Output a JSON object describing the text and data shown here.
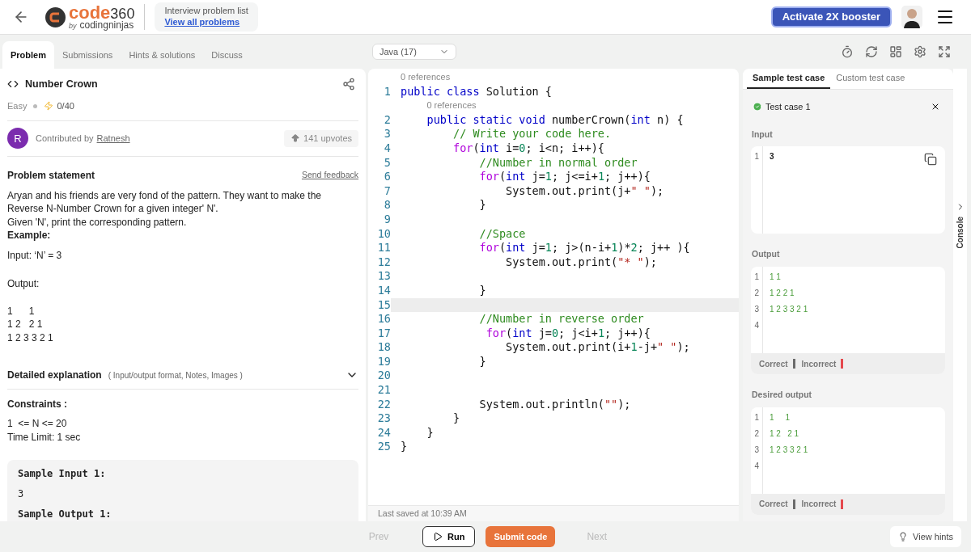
{
  "header": {
    "logo": {
      "word": "code",
      "number": "360",
      "by": "by",
      "brand": "codingninjas"
    },
    "list_box": {
      "title": "Interview problem list",
      "link": "View all problems"
    },
    "booster_button": "Activate 2X booster"
  },
  "problem_tabs": [
    {
      "label": "Problem",
      "selected": true
    },
    {
      "label": "Submissions",
      "selected": false
    },
    {
      "label": "Hints & solutions",
      "selected": false
    },
    {
      "label": "Discuss",
      "selected": false
    }
  ],
  "problem": {
    "title": "Number Crown",
    "difficulty": "Easy",
    "score": "0/40",
    "avatar_letter": "R",
    "contributed_by": "Contributed by",
    "author": "Ratnesh",
    "upvotes": "141 upvotes",
    "statement_heading": "Problem statement",
    "feedback_link": "Send feedback",
    "paragraphs": [
      "Aryan and his friends are very fond of the pattern. They want to make the Reverse N-Number Crown for a given integer' N'.",
      "Given 'N', print the corresponding pattern."
    ],
    "example_heading": "Example:",
    "example_input": "Input: ‘N’ = 3",
    "output_label": "Output:",
    "pattern": [
      "1      1",
      "1 2   2 1",
      "1 2 3 3 2 1"
    ],
    "explanation": {
      "heading": "Detailed explanation",
      "hint": "( Input/output format, Notes, Images )",
      "expanded": false
    },
    "constraints_heading": "Constraints :",
    "constraints": [
      "1  <= N <= 20",
      "Time Limit: 1 sec"
    ],
    "sample": [
      {
        "kind": "heading",
        "text": "Sample Input 1:"
      },
      {
        "kind": "value",
        "text": "3"
      },
      {
        "kind": "heading",
        "text": "Sample Output 1:"
      }
    ]
  },
  "editor": {
    "language": "Java (17)",
    "last_saved": "Last saved at 10:39 AM",
    "lines": [
      {
        "number": "1",
        "current": false,
        "lens": "0 references",
        "tokens": [
          {
            "kind": "kw",
            "text": "public class "
          },
          {
            "kind": "plain",
            "text": "Solution {"
          }
        ]
      },
      {
        "number": "2",
        "current": false,
        "lens": "0 references",
        "tokens": [
          {
            "kind": "kw",
            "text": "    public static void "
          },
          {
            "kind": "plain",
            "text": "numberCrown("
          },
          {
            "kind": "kw",
            "text": "int"
          },
          {
            "kind": "plain",
            "text": " n) {"
          }
        ]
      },
      {
        "number": "3",
        "current": false,
        "tokens": [
          {
            "kind": "comment",
            "text": "        // Write your code here."
          }
        ]
      },
      {
        "number": "4",
        "current": false,
        "tokens": [
          {
            "kind": "ctrl",
            "text": "        for"
          },
          {
            "kind": "plain",
            "text": "("
          },
          {
            "kind": "kw",
            "text": "int"
          },
          {
            "kind": "plain",
            "text": " i="
          },
          {
            "kind": "num",
            "text": "0"
          },
          {
            "kind": "plain",
            "text": "; i<n; i++){"
          }
        ]
      },
      {
        "number": "5",
        "current": false,
        "tokens": [
          {
            "kind": "comment",
            "text": "            //Number in normal order"
          }
        ]
      },
      {
        "number": "6",
        "current": false,
        "tokens": [
          {
            "kind": "ctrl",
            "text": "            for"
          },
          {
            "kind": "plain",
            "text": "("
          },
          {
            "kind": "kw",
            "text": "int"
          },
          {
            "kind": "plain",
            "text": " j="
          },
          {
            "kind": "num",
            "text": "1"
          },
          {
            "kind": "plain",
            "text": "; j<=i+"
          },
          {
            "kind": "num",
            "text": "1"
          },
          {
            "kind": "plain",
            "text": "; j++){"
          }
        ]
      },
      {
        "number": "7",
        "current": false,
        "tokens": [
          {
            "kind": "plain",
            "text": "                System.out.print(j+"
          },
          {
            "kind": "str",
            "text": "\" \""
          },
          {
            "kind": "plain",
            "text": ");"
          }
        ]
      },
      {
        "number": "8",
        "current": false,
        "tokens": [
          {
            "kind": "plain",
            "text": "            }"
          }
        ]
      },
      {
        "number": "9",
        "current": false
      },
      {
        "number": "10",
        "current": false,
        "tokens": [
          {
            "kind": "comment",
            "text": "            //Space"
          }
        ]
      },
      {
        "number": "11",
        "current": false,
        "tokens": [
          {
            "kind": "ctrl",
            "text": "            for"
          },
          {
            "kind": "plain",
            "text": "("
          },
          {
            "kind": "kw",
            "text": "int"
          },
          {
            "kind": "plain",
            "text": " j="
          },
          {
            "kind": "num",
            "text": "1"
          },
          {
            "kind": "plain",
            "text": "; j>(n-i+"
          },
          {
            "kind": "num",
            "text": "1"
          },
          {
            "kind": "plain",
            "text": ")*"
          },
          {
            "kind": "num",
            "text": "2"
          },
          {
            "kind": "plain",
            "text": "; j++ ){"
          }
        ]
      },
      {
        "number": "12",
        "current": false,
        "tokens": [
          {
            "kind": "plain",
            "text": "                System.out.print("
          },
          {
            "kind": "str",
            "text": "\"* \""
          },
          {
            "kind": "plain",
            "text": ");"
          }
        ]
      },
      {
        "number": "13",
        "current": false
      },
      {
        "number": "14",
        "current": false,
        "tokens": [
          {
            "kind": "plain",
            "text": "            }"
          }
        ]
      },
      {
        "number": "15",
        "current": true
      },
      {
        "number": "16",
        "current": false,
        "tokens": [
          {
            "kind": "comment",
            "text": "            //Number in reverse order"
          }
        ]
      },
      {
        "number": "17",
        "current": false,
        "tokens": [
          {
            "kind": "ctrl",
            "text": "             for"
          },
          {
            "kind": "plain",
            "text": "("
          },
          {
            "kind": "kw",
            "text": "int"
          },
          {
            "kind": "plain",
            "text": " j="
          },
          {
            "kind": "num",
            "text": "0"
          },
          {
            "kind": "plain",
            "text": "; j<i+"
          },
          {
            "kind": "num",
            "text": "1"
          },
          {
            "kind": "plain",
            "text": "; j++){"
          }
        ]
      },
      {
        "number": "18",
        "current": false,
        "tokens": [
          {
            "kind": "plain",
            "text": "                System.out.print(i+"
          },
          {
            "kind": "num",
            "text": "1"
          },
          {
            "kind": "plain",
            "text": "-j+"
          },
          {
            "kind": "str",
            "text": "\" \""
          },
          {
            "kind": "plain",
            "text": ");"
          }
        ]
      },
      {
        "number": "19",
        "current": false,
        "tokens": [
          {
            "kind": "plain",
            "text": "            }"
          }
        ]
      },
      {
        "number": "20",
        "current": false
      },
      {
        "number": "21",
        "current": false
      },
      {
        "number": "22",
        "current": false,
        "tokens": [
          {
            "kind": "plain",
            "text": "            System.out.println("
          },
          {
            "kind": "str",
            "text": "\"\""
          },
          {
            "kind": "plain",
            "text": ");"
          }
        ]
      },
      {
        "number": "23",
        "current": false,
        "tokens": [
          {
            "kind": "plain",
            "text": "        }"
          }
        ]
      },
      {
        "number": "24",
        "current": false,
        "tokens": [
          {
            "kind": "plain",
            "text": "    }"
          }
        ]
      },
      {
        "number": "25",
        "current": false,
        "tokens": [
          {
            "kind": "plain",
            "text": "}"
          }
        ]
      }
    ]
  },
  "tests": {
    "tabs": [
      {
        "label": "Sample test case",
        "selected": true
      },
      {
        "label": "Custom test case",
        "selected": false
      }
    ],
    "case": {
      "label": "Test case 1",
      "passed": true
    },
    "blocks": [
      {
        "label": "Input",
        "kind": "input",
        "lines": [
          {
            "number": "1",
            "text": "3"
          }
        ]
      },
      {
        "label": "Output",
        "kind": "output",
        "lines": [
          {
            "number": "1",
            "text": "1 1"
          },
          {
            "number": "2",
            "text": "1 2 2 1"
          },
          {
            "number": "3",
            "text": "1 2 3 3 2 1"
          },
          {
            "number": "4"
          }
        ],
        "legend": [
          {
            "label": "Correct",
            "color": "#6b6b6b"
          },
          {
            "label": "Incorrect",
            "color": "#e5484d"
          }
        ]
      },
      {
        "label": "Desired output",
        "kind": "output",
        "lines": [
          {
            "number": "1",
            "text": "1     1"
          },
          {
            "number": "2",
            "text": "1 2   2 1"
          },
          {
            "number": "3",
            "text": "1 2 3 3 2 1"
          },
          {
            "number": "4"
          }
        ],
        "legend": [
          {
            "label": "Correct",
            "color": "#6b6b6b"
          },
          {
            "label": "Incorrect",
            "color": "#e5484d"
          }
        ]
      }
    ]
  },
  "console_label": "Console",
  "footer": {
    "prev": "Prev",
    "run": "Run",
    "submit": "Submit code",
    "next": "Next",
    "hints": "View hints"
  }
}
